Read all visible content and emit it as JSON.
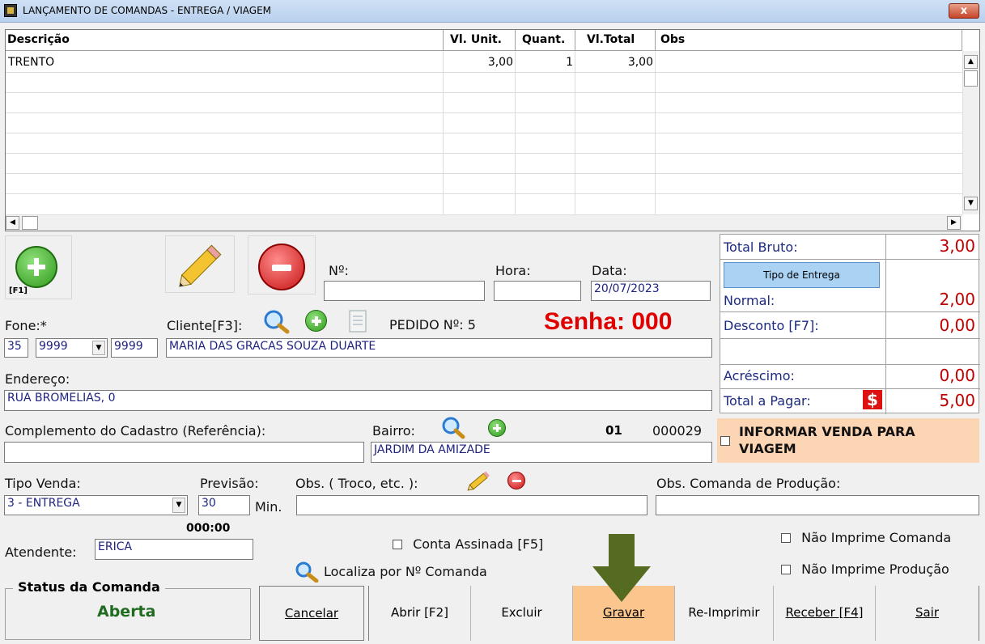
{
  "window": {
    "title": "LANÇAMENTO DE COMANDAS - ENTREGA / VIAGEM",
    "close": "x"
  },
  "grid": {
    "columns": [
      "Descrição",
      "Vl. Unit.",
      "Quant.",
      "Vl.Total",
      "Obs"
    ],
    "rows": [
      {
        "descricao": "TRENTO",
        "vl_unit": "3,00",
        "quant": "1",
        "vl_total": "3,00",
        "obs": ""
      }
    ]
  },
  "toolbar": {
    "add_hint": "[F1]"
  },
  "order": {
    "no_label": "Nº:",
    "no_value": "",
    "hora_label": "Hora:",
    "hora_value": "",
    "data_label": "Data:",
    "data_value": "20/07/2023"
  },
  "client": {
    "fone_label": "Fone:*",
    "fone_ddd": "35",
    "fone_prefix": "9999",
    "fone_number": "9999",
    "cliente_label": "Cliente[F3]:",
    "cliente_value": "MARIA DAS GRACAS SOUZA DUARTE",
    "pedido": "PEDIDO Nº: 5",
    "senha": "Senha: 000",
    "endereco_label": "Endereço:",
    "endereco_value": "RUA BROMELIAS, 0",
    "complemento_label": "Complemento do Cadastro (Referência):",
    "complemento_value": "",
    "bairro_label": "Bairro:",
    "bairro_code": "01",
    "bairro_id": "000029",
    "bairro_value": "JARDIM DA AMIZADE"
  },
  "totals": {
    "total_bruto_label": "Total Bruto:",
    "total_bruto": "3,00",
    "tipo_entrega_button": "Tipo de Entrega",
    "normal_label": "Normal:",
    "normal": "2,00",
    "desconto_label": "Desconto [F7]:",
    "desconto": "0,00",
    "acrescimo_label": "Acréscimo:",
    "acrescimo": "0,00",
    "total_pagar_label": "Total a Pagar:",
    "total_pagar": "5,00",
    "currency_icon_text": "$"
  },
  "viagem": {
    "label": "INFORMAR VENDA PARA VIAGEM"
  },
  "sale": {
    "tipo_venda_label": "Tipo Venda:",
    "tipo_venda_value": "3 - ENTREGA",
    "previsao_label": "Previsão:",
    "previsao_value": "30",
    "min_label": "Min.",
    "obs_label": "Obs. ( Troco, etc. ):",
    "obs_value": "",
    "obs_producao_label": "Obs. Comanda de Produção:",
    "obs_producao_value": "",
    "timer": "000:00",
    "atendente_label": "Atendente:",
    "atendente_value": "ERICA",
    "conta_assinada": "Conta Assinada [F5]",
    "localiza": "Localiza por Nº Comanda",
    "nao_imprime_comanda": "Não Imprime Comanda",
    "nao_imprime_producao": "Não Imprime Produção"
  },
  "status": {
    "title": "Status da Comanda",
    "value": "Aberta"
  },
  "buttons": {
    "cancelar": "Cancelar",
    "abrir": "Abrir [F2]",
    "excluir": "Excluir",
    "gravar": "Gravar",
    "reimprimir": "Re-Imprimir",
    "receber": "Receber [F4]",
    "sair": "Sair"
  },
  "colors": {
    "accent_gravar": "#fbc58e",
    "viagem_bg": "#fcd6b4",
    "total_red": "#c00000",
    "senha_red": "#e00000",
    "status_green": "#1f6b1f",
    "arrow": "#556b22"
  }
}
